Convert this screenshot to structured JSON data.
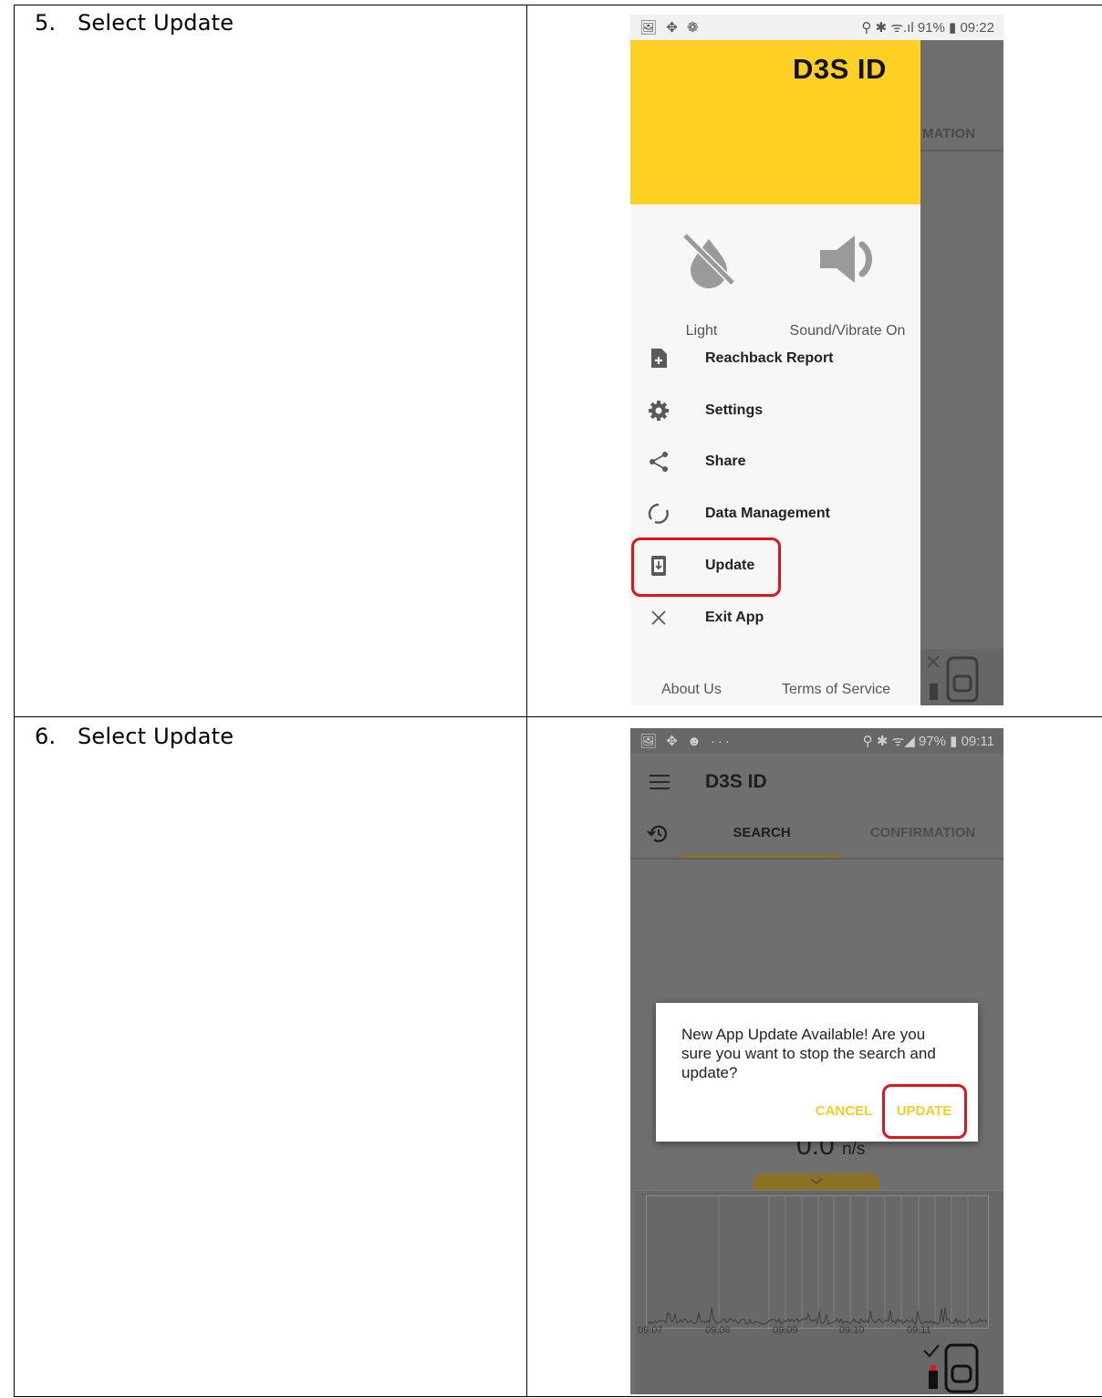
{
  "steps": [
    {
      "number": "5.",
      "text": "Select Update"
    },
    {
      "number": "6.",
      "text": "Select Update"
    }
  ],
  "screen1": {
    "status_left": "🖼 ✥ ❁",
    "status_right": "⚲ ✱ ᯤ.ıl 91% ▮ 09:22",
    "app_title": "D3S ID",
    "bg_tab_partial": "MATION",
    "toggle_light_label": "Light",
    "toggle_sound_label": "Sound/Vibrate On",
    "menu": [
      {
        "label": "Reachback Report",
        "icon": "file-plus-icon"
      },
      {
        "label": "Settings",
        "icon": "gear-icon"
      },
      {
        "label": "Share",
        "icon": "share-icon"
      },
      {
        "label": "Data Management",
        "icon": "circle-arrows-icon"
      },
      {
        "label": "Update",
        "icon": "download-phone-icon"
      },
      {
        "label": "Exit App",
        "icon": "close-icon"
      }
    ],
    "footer_about": "About Us",
    "footer_terms": "Terms of Service",
    "accent": "#fdd023",
    "highlight": "#e0141b"
  },
  "screen2": {
    "status_left": "🖼 ✥ ☻ ···",
    "status_right": "⚲ ✱ ᯤ◢ 97% ▮ 09:11",
    "app_title": "D3S ID",
    "tab_search": "SEARCH",
    "tab_confirmation": "CONFIRMATION",
    "reading_value": "0.0",
    "reading_unit": "n/s",
    "dialog_text": "New App Update Available! Are you sure you want to stop the search and update?",
    "dialog_cancel": "CANCEL",
    "dialog_update": "UPDATE",
    "time_ticks": [
      "09:07",
      "09:08",
      "09:09",
      "09:10",
      "09:11"
    ]
  }
}
